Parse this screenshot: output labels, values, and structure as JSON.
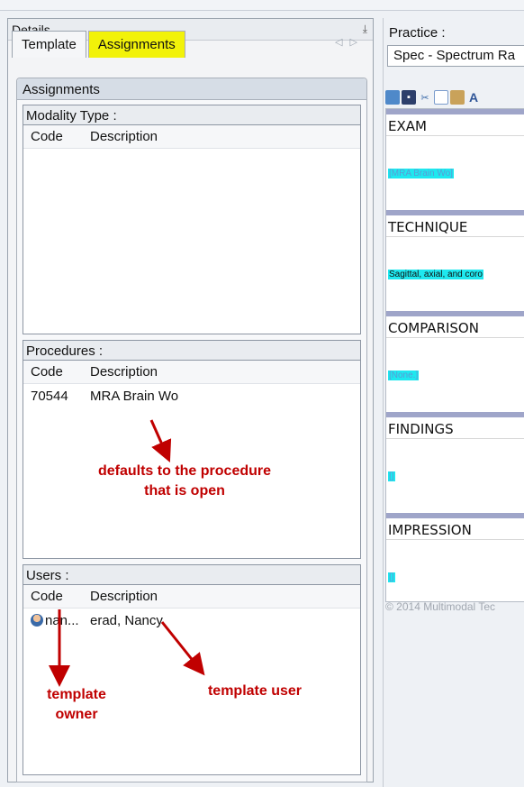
{
  "panel": {
    "title": "Details",
    "pin_icon": "pin-icon"
  },
  "tabs": [
    {
      "label": "Template",
      "active": false
    },
    {
      "label": "Assignments",
      "active": true
    }
  ],
  "assignments": {
    "title": "Assignments",
    "modality": {
      "title": "Modality Type :",
      "col_code": "Code",
      "col_desc": "Description",
      "rows": []
    },
    "procedures": {
      "title": "Procedures :",
      "col_code": "Code",
      "col_desc": "Description",
      "rows": [
        {
          "code": "70544",
          "desc": "MRA Brain Wo"
        }
      ]
    },
    "users": {
      "title": "Users :",
      "col_code": "Code",
      "col_desc": "Description",
      "rows": [
        {
          "code": "nan...",
          "desc": "erad, Nancy"
        }
      ]
    }
  },
  "annotations": {
    "procedure_default": "defaults to the procedure\nthat is open",
    "template_owner": "template\nowner",
    "template_user": "template user",
    "color": "#c00000"
  },
  "right": {
    "practice_label": "Practice :",
    "practice_value": "Spec - Spectrum Ra",
    "sections": [
      {
        "heading": "EXAM",
        "body": "[MRA Brain Wo]"
      },
      {
        "heading": "TECHNIQUE",
        "body": "Sagittal, axial, and coro"
      },
      {
        "heading": "COMPARISON",
        "body": "[None.]"
      },
      {
        "heading": "FINDINGS",
        "body": "[]"
      },
      {
        "heading": "IMPRESSION",
        "body": "[]"
      }
    ],
    "copyright": "© 2014 Multimodal Tec"
  },
  "colors": {
    "highlight": "#1ee8ef",
    "tab_active": "#f2f20a",
    "section_bar": "#9fa5c9"
  }
}
